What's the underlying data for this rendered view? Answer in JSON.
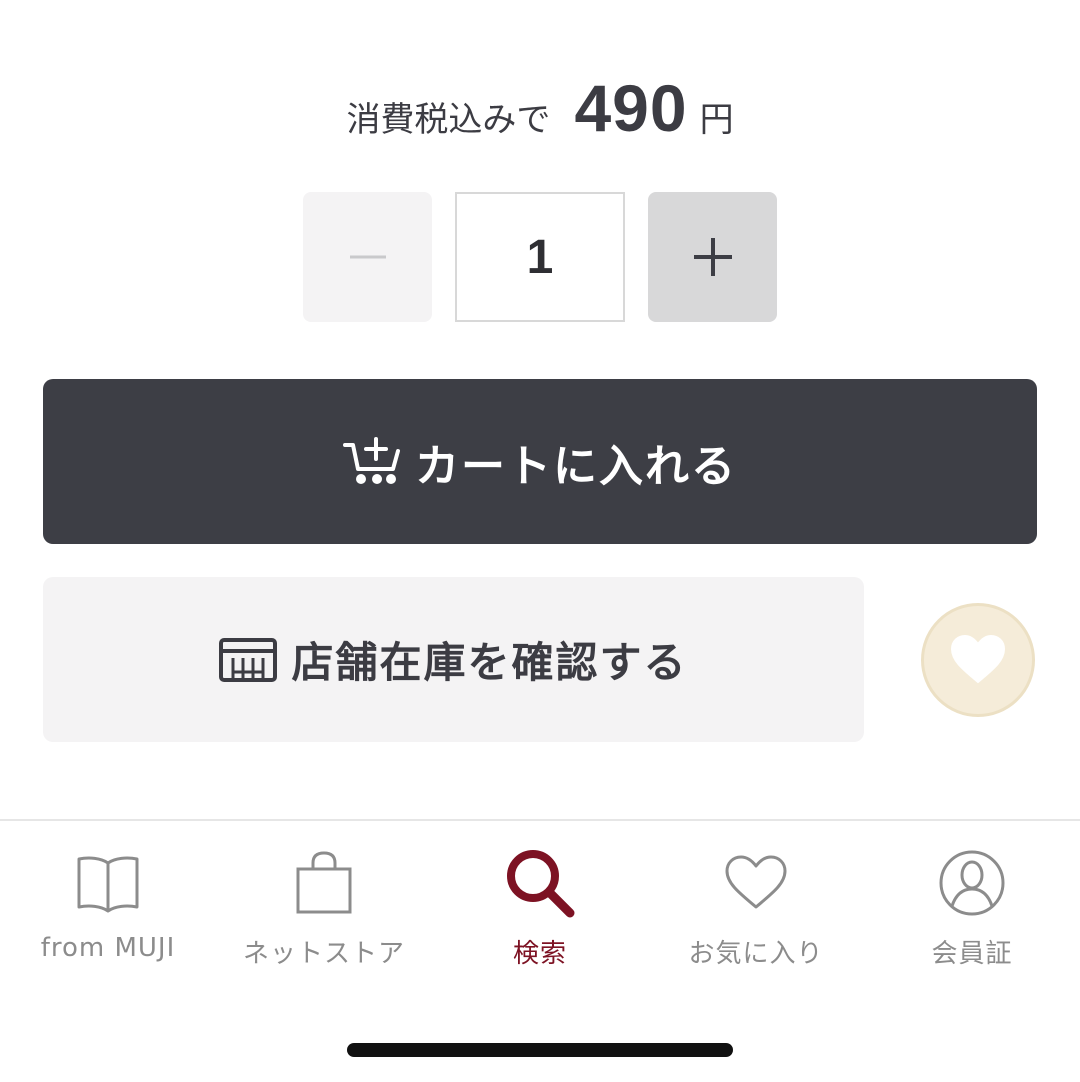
{
  "price": {
    "prefix": "消費税込みで",
    "amount": "490",
    "unit": "円"
  },
  "quantity": {
    "value": "1",
    "minus_icon": "minus-icon",
    "plus_icon": "plus-icon"
  },
  "actions": {
    "add_to_cart_label": "カートに入れる",
    "add_to_cart_icon": "cart-plus-icon",
    "check_stock_label": "店舗在庫を確認する",
    "check_stock_icon": "store-icon",
    "favorite_icon": "heart-icon"
  },
  "tabbar": {
    "items": [
      {
        "label": "from MUJI",
        "icon": "book-icon",
        "active": false
      },
      {
        "label": "ネットストア",
        "icon": "shopping-bag-icon",
        "active": false
      },
      {
        "label": "検索",
        "icon": "search-icon",
        "active": true
      },
      {
        "label": "お気に入り",
        "icon": "heart-icon",
        "active": false
      },
      {
        "label": "会員証",
        "icon": "user-icon",
        "active": false
      }
    ]
  },
  "colors": {
    "primary_button": "#3d3e45",
    "secondary_button": "#f4f3f4",
    "active_tab": "#7d1223",
    "inactive_tab": "#8c8c8c",
    "favorite_bg": "#f5ecd9"
  }
}
